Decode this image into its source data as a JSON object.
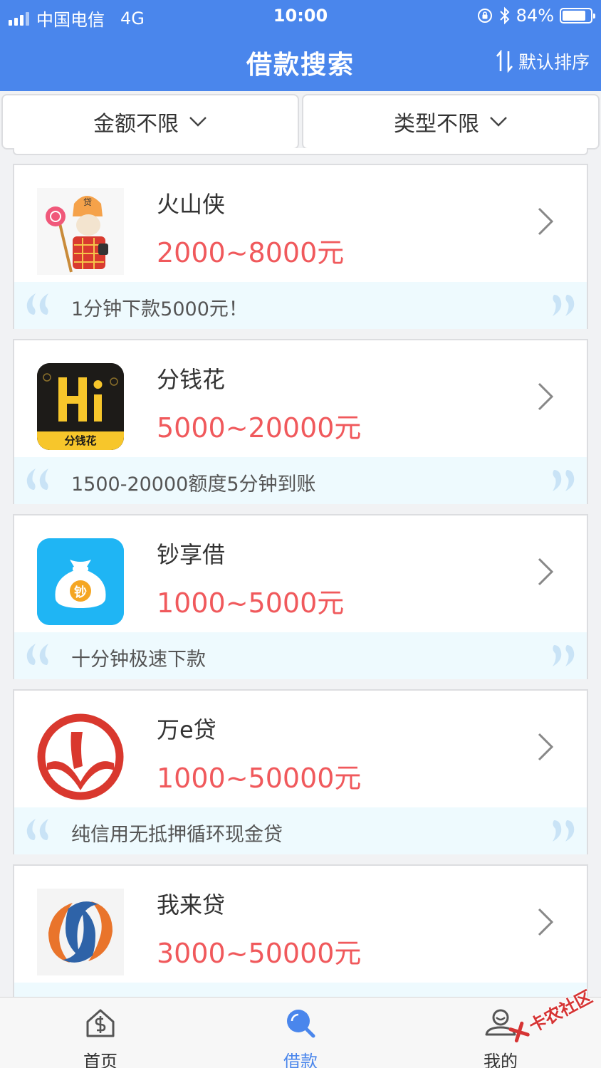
{
  "status": {
    "carrier": "中国电信",
    "network": "4G",
    "time": "10:00",
    "battery": "84%",
    "battery_level": 0.84
  },
  "header": {
    "title": "借款搜索",
    "sort_label": "默认排序"
  },
  "filters": {
    "amount": "金额不限",
    "type": "类型不限"
  },
  "products": [
    {
      "name": "火山侠",
      "amount": "2000~8000元",
      "slogan": "1分钟下款5000元！"
    },
    {
      "name": "分钱花",
      "amount": "5000~20000元",
      "slogan": "1500-20000额度5分钟到账",
      "logo_text": "分钱花"
    },
    {
      "name": "钞享借",
      "amount": "1000~5000元",
      "slogan": "十分钟极速下款",
      "logo_text": "钞"
    },
    {
      "name": "万e贷",
      "amount": "1000~50000元",
      "slogan": "纯信用无抵押循环现金贷"
    },
    {
      "name": "我来贷",
      "amount": "3000~50000元",
      "slogan": ""
    }
  ],
  "tabs": [
    {
      "label": "首页",
      "icon": "home-icon"
    },
    {
      "label": "借款",
      "icon": "search-icon"
    },
    {
      "label": "我的",
      "icon": "user-icon"
    }
  ],
  "watermark": "卡农社区",
  "colors": {
    "brand": "#4a86ec",
    "amount": "#f0595c",
    "slogan_bg": "#eefafe"
  }
}
